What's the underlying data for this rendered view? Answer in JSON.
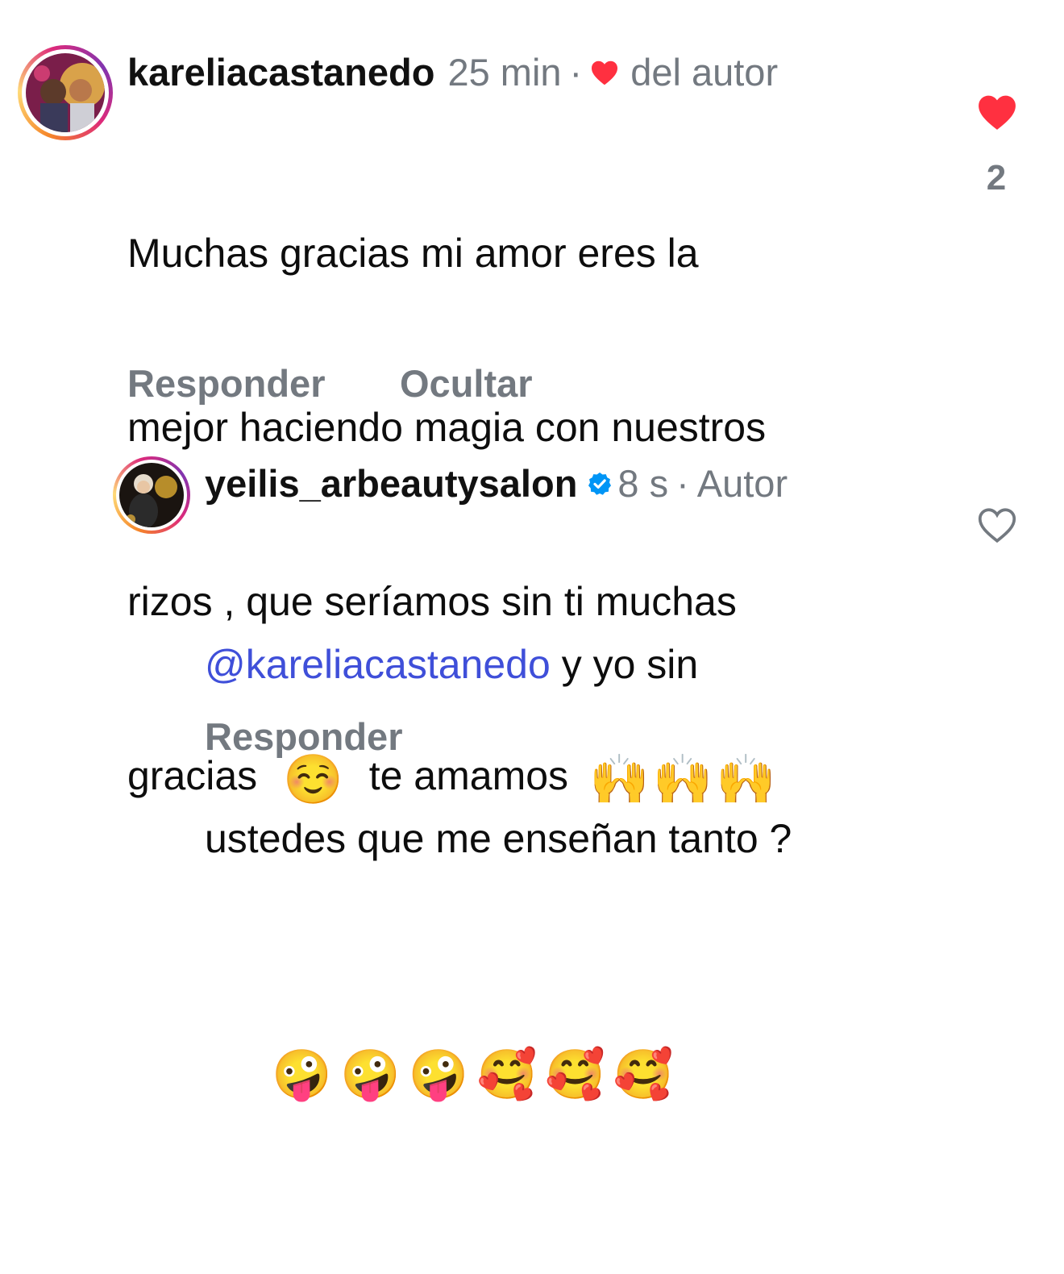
{
  "comments": [
    {
      "username": "kareliacastanedo",
      "time": "25 min",
      "separator": "·",
      "badge": "del autor",
      "liked_by_author": true,
      "text_lines": [
        "Muchas gracias mi amor eres la",
        "mejor haciendo magia con nuestros",
        "rizos , que seríamos sin ti muchas"
      ],
      "last_line_text_a": "gracias",
      "last_line_text_b": "te amamos",
      "emoji_smile": "☺️",
      "emoji_raise": "🙌🙌🙌",
      "like_count": "2",
      "liked": true,
      "actions": {
        "reply": "Responder",
        "hide": "Ocultar"
      }
    },
    {
      "username": "yeilis_arbeautysalon",
      "verified": true,
      "time": "8 s",
      "separator": "·",
      "badge": "Autor",
      "mention": "@kareliacastanedo",
      "text_after_mention": "y yo sin",
      "text_line_2": "ustedes que me enseñan tanto ?",
      "emoji_line": "🤪🤪🤪🥰🥰🥰",
      "liked": false,
      "actions": {
        "reply": "Responder"
      }
    }
  ],
  "colors": {
    "heart_red": "#ff3040",
    "meta_gray": "#737980",
    "mention_blue": "#3f4fd9",
    "verified_blue": "#0095f6"
  }
}
